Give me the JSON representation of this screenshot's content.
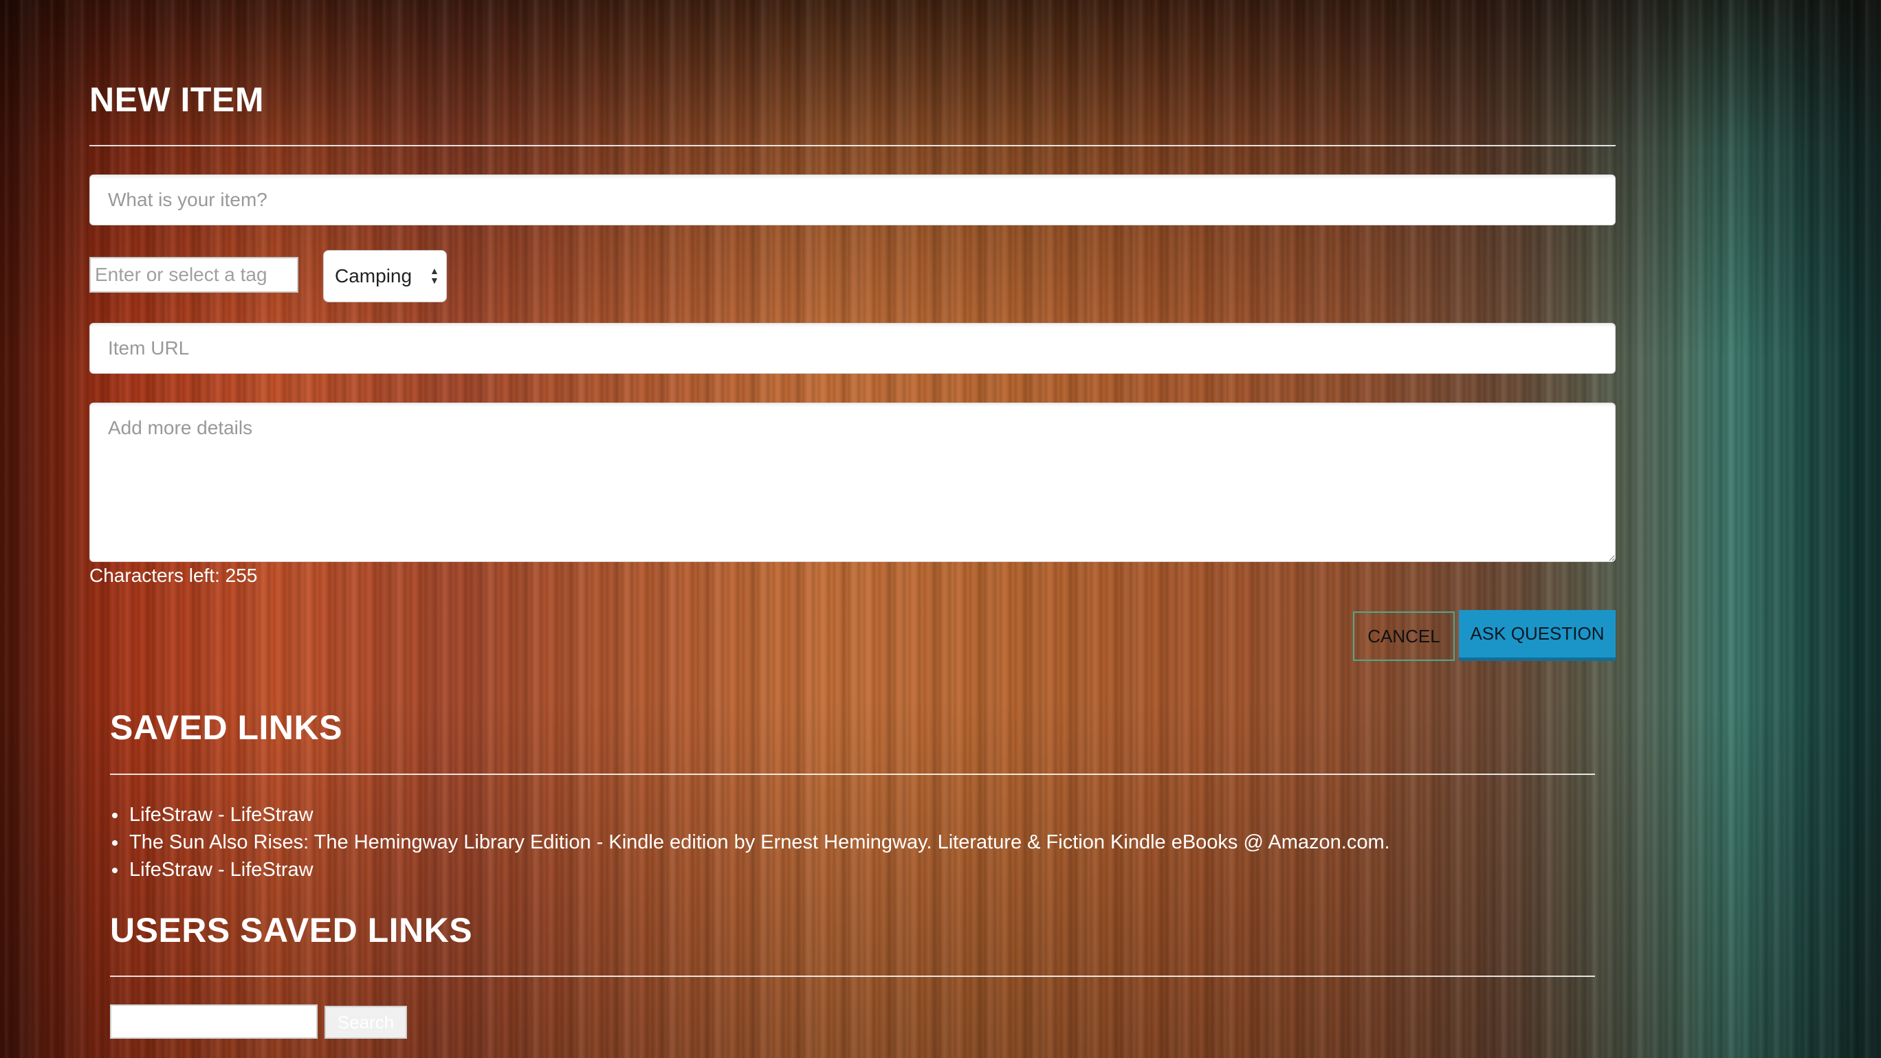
{
  "new_item": {
    "title": "NEW ITEM",
    "item_placeholder": "What is your item?",
    "tag_placeholder": "Enter or select a tag",
    "category_selected": "Camping",
    "url_placeholder": "Item URL",
    "details_placeholder": "Add more details",
    "char_counter_label": "Characters left:",
    "char_counter_value": "255",
    "cancel_label": "CANCEL",
    "submit_label": "ASK QUESTION"
  },
  "saved_links": {
    "title": "SAVED LINKS",
    "items": [
      {
        "label": "LifeStraw - LifeStraw"
      },
      {
        "label": "The Sun Also Rises: The Hemingway Library Edition - Kindle edition by Ernest Hemingway. Literature & Fiction Kindle eBooks @ Amazon.com."
      },
      {
        "label": "LifeStraw - LifeStraw"
      }
    ]
  },
  "users_saved_links": {
    "title": "USERS SAVED LINKS",
    "search_value": "",
    "search_button_label": "Search"
  },
  "colors": {
    "accent_button": "#1b95c8",
    "cancel_border": "#4ea989",
    "text": "#ffffff"
  },
  "icons": {
    "select_arrows": "select-updown-arrows-icon"
  }
}
